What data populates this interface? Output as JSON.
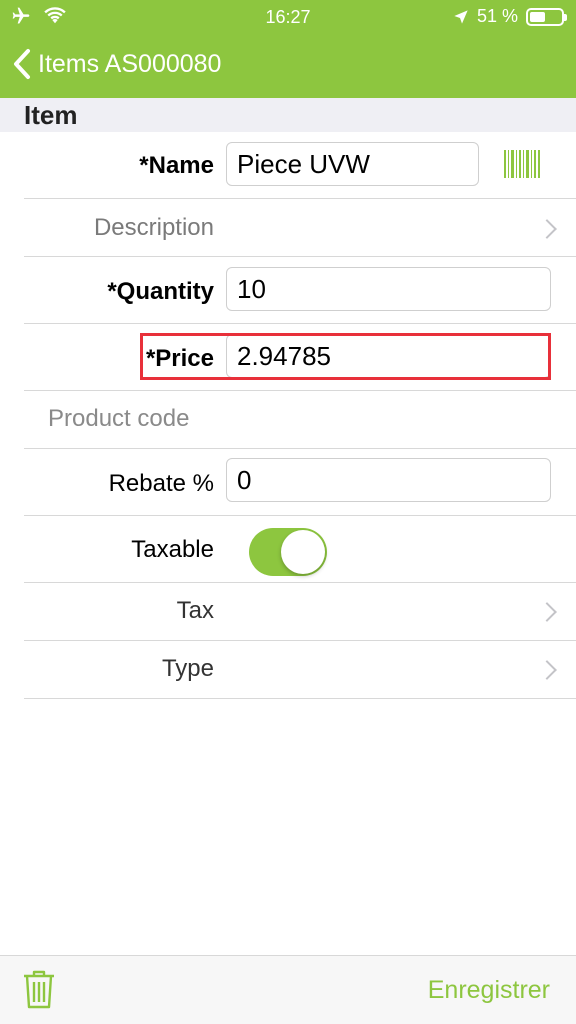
{
  "status_bar": {
    "time": "16:27",
    "battery_text": "51 %",
    "battery_level": 0.51,
    "icons": [
      "airplane-icon",
      "wifi-icon",
      "location-icon",
      "battery-icon"
    ]
  },
  "nav": {
    "back_title": "Items AS000080"
  },
  "section": {
    "title": "Item"
  },
  "form": {
    "name_label": "*Name",
    "name_value": "Piece UVW",
    "description_label": "Description",
    "quantity_label": "*Quantity",
    "quantity_value": "10",
    "price_label": "*Price",
    "price_value": "2.94785",
    "product_code_label": "Product code",
    "rebate_label": "Rebate %",
    "rebate_value": "0",
    "taxable_label": "Taxable",
    "taxable_on": true,
    "tax_label": "Tax",
    "type_label": "Type"
  },
  "toolbar": {
    "save_label": "Enregistrer"
  },
  "colors": {
    "accent": "#8dc63f",
    "highlight": "#e8303a"
  }
}
